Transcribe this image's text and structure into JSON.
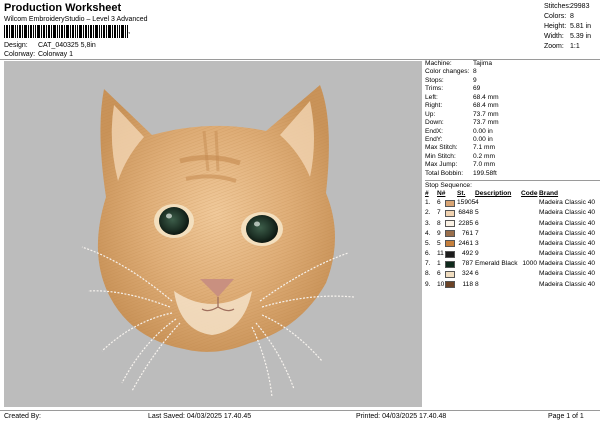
{
  "header": {
    "title": "Production Worksheet",
    "subtitle": "Wilcom EmbroideryStudio – Level 3 Advanced",
    "mark": ",",
    "design_label": "Design:",
    "design_value": "CAT_040325 5,8in",
    "colorway_label": "Colorway:",
    "colorway_value": "Colorway 1"
  },
  "stats": [
    {
      "label": "Stitches:",
      "value": "29983"
    },
    {
      "label": "Colors:",
      "value": "8"
    },
    {
      "label": "Height:",
      "value": "5.81 in"
    },
    {
      "label": "Width:",
      "value": "5.39 in"
    },
    {
      "label": "Zoom:",
      "value": "1:1"
    }
  ],
  "machine_info": [
    {
      "label": "Machine:",
      "value": "Tajima"
    },
    {
      "label": "Color changes:",
      "value": "8"
    },
    {
      "label": "Stops:",
      "value": "9"
    },
    {
      "label": "Trims:",
      "value": "69"
    },
    {
      "label": "Left:",
      "value": "68.4 mm"
    },
    {
      "label": "Right:",
      "value": "68.4 mm"
    },
    {
      "label": "Up:",
      "value": "73.7 mm"
    },
    {
      "label": "Down:",
      "value": "73.7 mm"
    },
    {
      "label": "EndX:",
      "value": "0.00 in"
    },
    {
      "label": "EndY:",
      "value": "0.00 in"
    },
    {
      "label": "Max Stitch:",
      "value": "7.1 mm"
    },
    {
      "label": "Min Stitch:",
      "value": "0.2 mm"
    },
    {
      "label": "Max Jump:",
      "value": "7.0 mm"
    },
    {
      "label": "Total Bobbin:",
      "value": "199.58ft"
    }
  ],
  "sequence": {
    "title": "Stop Sequence:",
    "headers": {
      "index": "#",
      "needle": "N#",
      "st": "St.",
      "description": "Description",
      "code": "Code",
      "brand": "Brand"
    },
    "rows": [
      {
        "index": "1.",
        "needle": "6",
        "color": "#d9a574",
        "st": "15905",
        "description": "4",
        "code": "",
        "brand": "Madeira Classic 40"
      },
      {
        "index": "2.",
        "needle": "7",
        "color": "#f1d3b1",
        "st": "6848",
        "description": "5",
        "code": "",
        "brand": "Madeira Classic 40"
      },
      {
        "index": "3.",
        "needle": "8",
        "color": "#faf1e4",
        "st": "2285",
        "description": "6",
        "code": "",
        "brand": "Madeira Classic 40"
      },
      {
        "index": "4.",
        "needle": "9",
        "color": "#9a6f4c",
        "st": "761",
        "description": "7",
        "code": "",
        "brand": "Madeira Classic 40"
      },
      {
        "index": "5.",
        "needle": "5",
        "color": "#c57f3c",
        "st": "2461",
        "description": "3",
        "code": "",
        "brand": "Madeira Classic 40"
      },
      {
        "index": "6.",
        "needle": "11",
        "color": "#1c1c1c",
        "st": "492",
        "description": "9",
        "code": "",
        "brand": "Madeira Classic 40"
      },
      {
        "index": "7.",
        "needle": "1",
        "color": "#0f2a1c",
        "st": "787",
        "description": "Emerald Black",
        "code": "1000",
        "brand": "Madeira Classic 40"
      },
      {
        "index": "8.",
        "needle": "6",
        "color": "#f0ddc0",
        "st": "324",
        "description": "6",
        "code": "",
        "brand": "Madeira Classic 40"
      },
      {
        "index": "9.",
        "needle": "10",
        "color": "#6b4326",
        "st": "118",
        "description": "8",
        "code": "",
        "brand": "Madeira Classic 40"
      }
    ]
  },
  "footer": {
    "created_by": "Created By:",
    "last_saved": "Last Saved: 04/03/2025 17.40.45",
    "printed": "Printed: 04/03/2025 17.40.48",
    "page": "Page 1 of 1"
  },
  "colors": {
    "canvas_bg": "#bcbcbc",
    "fur_main": "#d9a574",
    "fur_light": "#f1d3b1",
    "eye_green": "#1f3b2d",
    "nose": "#c99080"
  }
}
